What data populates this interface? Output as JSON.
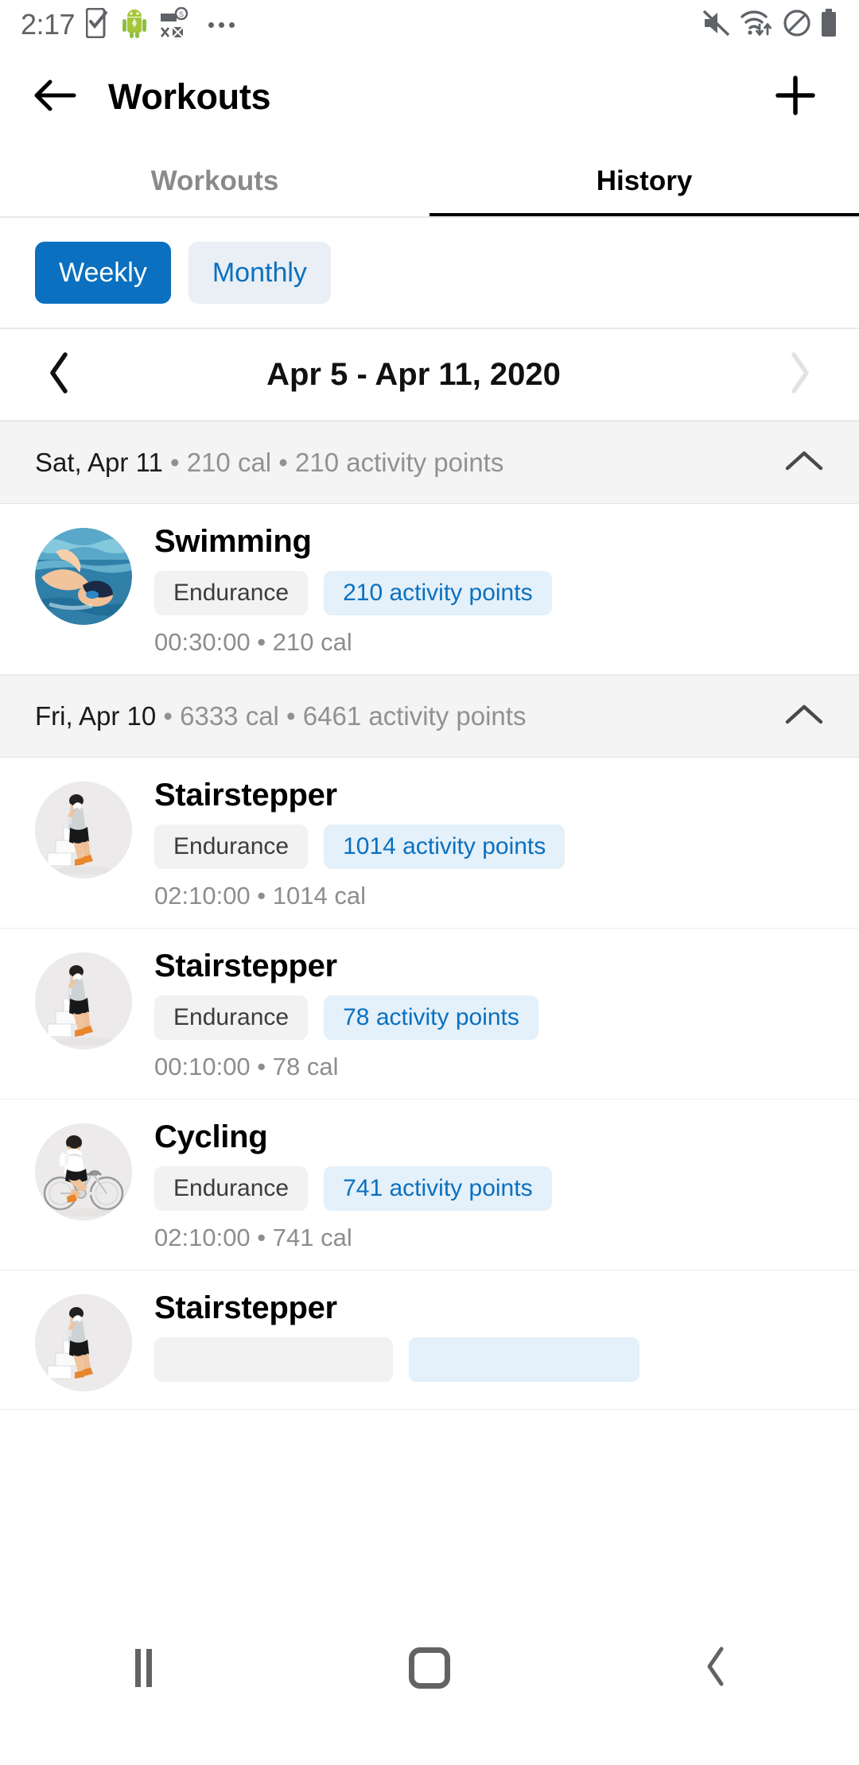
{
  "status_bar": {
    "time": "2:17",
    "left_icons": [
      "phone-check-icon",
      "android-robot-icon",
      "mail-blocked-icon",
      "overflow-dots-icon"
    ],
    "right_icons": [
      "volume-mute-icon",
      "wifi-data-icon",
      "do-not-disturb-icon",
      "battery-full-icon"
    ]
  },
  "appbar": {
    "back_icon": "arrow-left-icon",
    "title": "Workouts",
    "add_icon": "plus-icon"
  },
  "tabs": [
    {
      "label": "Workouts",
      "active": false
    },
    {
      "label": "History",
      "active": true
    }
  ],
  "period_toggle": {
    "options": [
      {
        "label": "Weekly",
        "selected": true
      },
      {
        "label": "Monthly",
        "selected": false
      }
    ],
    "selected_color": "#0a70bf",
    "unselected_bg": "#e9eff4"
  },
  "date_range": {
    "prev_icon": "chevron-left-icon",
    "label": "Apr 5 - Apr 11, 2020",
    "next_icon": "chevron-right-icon",
    "next_disabled": true
  },
  "days": [
    {
      "date": "Sat, Apr 11",
      "separator": " • ",
      "calories": "210 cal",
      "points": "210 activity points",
      "collapse_icon": "chevron-up-icon",
      "workouts": [
        {
          "name": "Swimming",
          "thumb": "swimming-photo",
          "type_chip": "Endurance",
          "points_chip": "210 activity points",
          "meta": "00:30:00 • 210 cal"
        }
      ]
    },
    {
      "date": "Fri, Apr 10",
      "separator": " • ",
      "calories": "6333 cal",
      "points": "6461 activity points",
      "collapse_icon": "chevron-up-icon",
      "workouts": [
        {
          "name": "Stairstepper",
          "thumb": "stairstepper-photo",
          "type_chip": "Endurance",
          "points_chip": "1014 activity points",
          "meta": "02:10:00 • 1014 cal"
        },
        {
          "name": "Stairstepper",
          "thumb": "stairstepper-photo",
          "type_chip": "Endurance",
          "points_chip": "78 activity points",
          "meta": "00:10:00 • 78 cal"
        },
        {
          "name": "Cycling",
          "thumb": "cycling-photo",
          "type_chip": "Endurance",
          "points_chip": "741 activity points",
          "meta": "02:10:00 • 741 cal"
        },
        {
          "name": "Stairstepper",
          "thumb": "stairstepper-photo",
          "type_chip": "",
          "points_chip": "",
          "meta": ""
        }
      ]
    }
  ],
  "navbar": {
    "recents_icon": "recents-icon",
    "home_icon": "home-icon",
    "back_icon": "nav-back-icon"
  }
}
